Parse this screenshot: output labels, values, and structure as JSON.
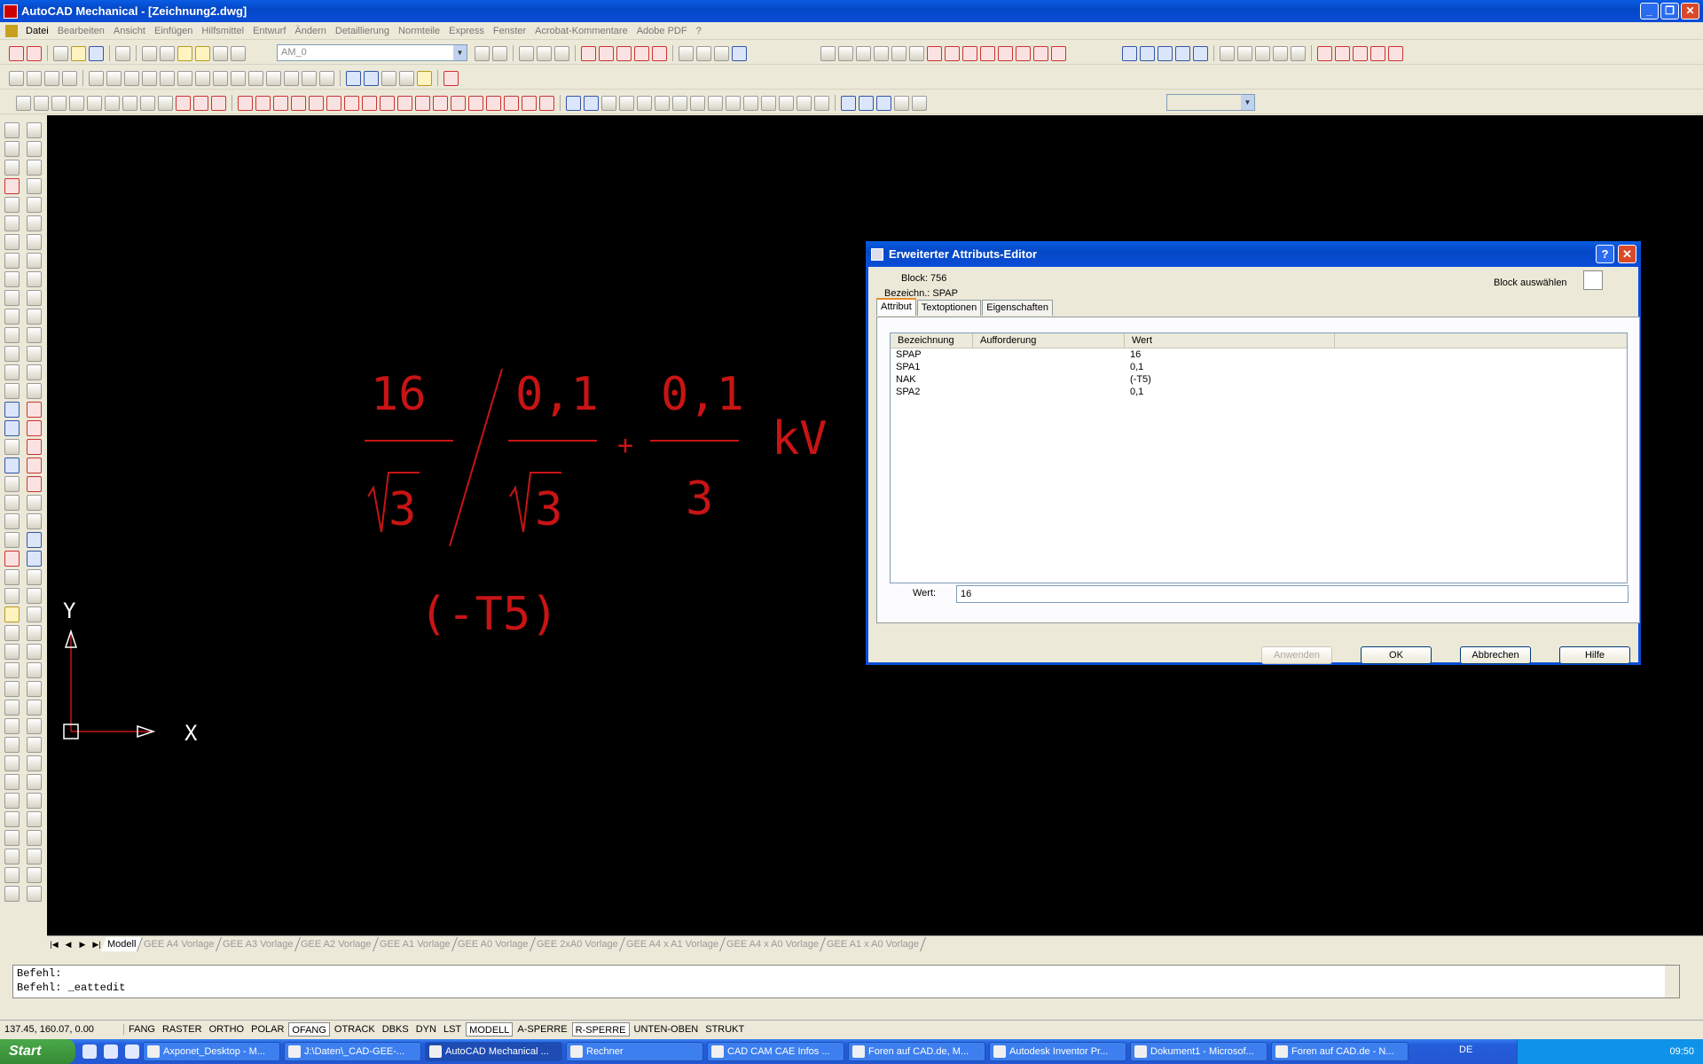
{
  "window": {
    "title": "AutoCAD Mechanical - [Zeichnung2.dwg]"
  },
  "menu": [
    "Datei",
    "Bearbeiten",
    "Ansicht",
    "Einfügen",
    "Hilfsmittel",
    "Entwurf",
    "Ändern",
    "Detaillierung",
    "Normteile",
    "Express",
    "Fenster",
    "Acrobat-Kommentare",
    "Adobe PDF",
    "?"
  ],
  "toolbar": {
    "layer_combo": "AM_0"
  },
  "drawing": {
    "numerator1": "16",
    "numerator2": "0,1",
    "numerator3": "0,1",
    "sqrt1": "3",
    "sqrt2": "3",
    "denominator3": "3",
    "plus": "+",
    "unit": "kV",
    "nak": "(-T5)",
    "axis_x": "X",
    "axis_y": "Y",
    "color": "#c81414"
  },
  "layout_tabs": [
    "Modell",
    "GEE A4 Vorlage",
    "GEE A3 Vorlage",
    "GEE A2 Vorlage",
    "GEE A1 Vorlage",
    "GEE A0 Vorlage",
    "GEE 2xA0 Vorlage",
    "GEE A4 x A1 Vorlage",
    "GEE A4 x A0 Vorlage",
    "GEE A1 x A0 Vorlage"
  ],
  "command": {
    "line1": "Befehl:",
    "line2": "Befehl: _eattedit"
  },
  "status": {
    "coords": "137.45, 160.07, 0.00",
    "buttons": [
      "FANG",
      "RASTER",
      "ORTHO",
      "POLAR",
      "OFANG",
      "OTRACK",
      "DBKS",
      "DYN",
      "LST",
      "MODELL",
      "A-SPERRE",
      "R-SPERRE",
      "UNTEN-OBEN",
      "STRUKT"
    ]
  },
  "taskbar": {
    "start": "Start",
    "tasks": [
      "Axponet_Desktop - M...",
      "J:\\Daten\\_CAD-GEE-...",
      "AutoCAD Mechanical ...",
      "Rechner",
      "CAD CAM CAE Infos ...",
      "Foren auf CAD.de, M...",
      "Autodesk Inventor Pr...",
      "Dokument1 - Microsof...",
      "Foren auf CAD.de - N..."
    ],
    "lang": "DE",
    "clock": "09:50"
  },
  "dialog": {
    "title": "Erweiterter Attributs-Editor",
    "block_label": "Block: 756",
    "name_label": "Bezeichn.: SPAP",
    "select_block": "Block auswählen",
    "tabs": [
      "Attribut",
      "Textoptionen",
      "Eigenschaften"
    ],
    "columns": [
      "Bezeichnung",
      "Aufforderung",
      "Wert"
    ],
    "rows": [
      {
        "name": "SPAP",
        "prompt": "",
        "value": "16"
      },
      {
        "name": "SPA1",
        "prompt": "",
        "value": "0,1"
      },
      {
        "name": "NAK",
        "prompt": "",
        "value": "(-T5)"
      },
      {
        "name": "SPA2",
        "prompt": "",
        "value": "0,1"
      }
    ],
    "value_label": "Wert:",
    "value": "16",
    "buttons": {
      "apply": "Anwenden",
      "ok": "OK",
      "cancel": "Abbrechen",
      "help": "Hilfe"
    }
  }
}
